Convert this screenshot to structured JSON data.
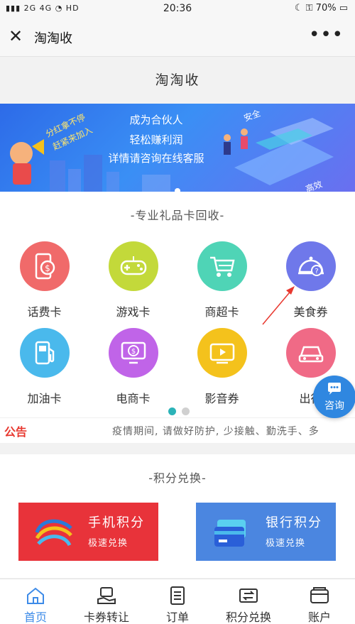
{
  "status_bar": {
    "signal_text": "2G 4G",
    "hd": "HD",
    "time": "20:36",
    "battery": "70%"
  },
  "top_bar": {
    "close_icon": "close-icon",
    "title": "淘淘收",
    "more_icon": "more-icon"
  },
  "page_header": {
    "title": "淘淘收"
  },
  "banner": {
    "line1": "成为合伙人",
    "line2": "轻松赚利润",
    "line3": "详情请咨询在线客服",
    "slogan1": "分红拿不停",
    "slogan2": "赶紧来加入",
    "tag_safe": "安全",
    "tag_efficient": "高效"
  },
  "gift_cards": {
    "section_title": "-专业礼品卡回收-",
    "items": [
      {
        "label": "话费卡",
        "icon": "phone-card-icon",
        "color": "#f06a6a"
      },
      {
        "label": "游戏卡",
        "icon": "gamepad-icon",
        "color": "#c3d93a"
      },
      {
        "label": "商超卡",
        "icon": "shopping-cart-icon",
        "color": "#4fd4b6"
      },
      {
        "label": "美食券",
        "icon": "food-cloche-icon",
        "color": "#6f78ea"
      },
      {
        "label": "加油卡",
        "icon": "gas-pump-icon",
        "color": "#4ab9ec"
      },
      {
        "label": "电商卡",
        "icon": "ecommerce-icon",
        "color": "#c064e8"
      },
      {
        "label": "影音券",
        "icon": "video-icon",
        "color": "#f4c21c"
      },
      {
        "label": "出行",
        "icon": "car-icon",
        "color": "#f06a86"
      }
    ]
  },
  "notice": {
    "tag": "公告",
    "text": "疫情期间, 请做好防护, 少接触、勤洗手、多"
  },
  "points": {
    "section_title": "-积分兑换-",
    "cards": [
      {
        "name": "手机积分",
        "sub": "极速兑换",
        "color": "#e8333a"
      },
      {
        "name": "银行积分",
        "sub": "极速兑换",
        "color": "#4b86e0"
      }
    ]
  },
  "chat_button": {
    "label": "咨询"
  },
  "tab_bar": {
    "tabs": [
      {
        "label": "首页",
        "icon": "home-icon",
        "active": true
      },
      {
        "label": "卡券转让",
        "icon": "transfer-icon",
        "active": false
      },
      {
        "label": "订单",
        "icon": "order-icon",
        "active": false
      },
      {
        "label": "积分兑换",
        "icon": "exchange-icon",
        "active": false
      },
      {
        "label": "账户",
        "icon": "wallet-icon",
        "active": false
      }
    ]
  }
}
